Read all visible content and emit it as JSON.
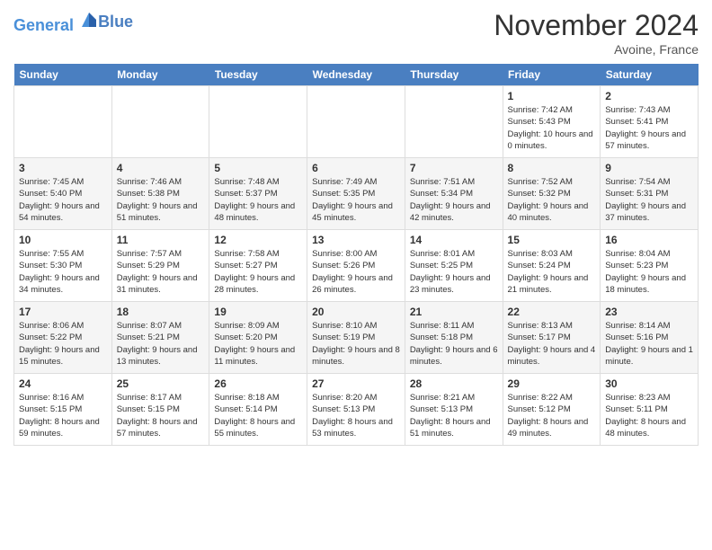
{
  "header": {
    "logo_line1": "General",
    "logo_line2": "Blue",
    "month": "November 2024",
    "location": "Avoine, France"
  },
  "days_of_week": [
    "Sunday",
    "Monday",
    "Tuesday",
    "Wednesday",
    "Thursday",
    "Friday",
    "Saturday"
  ],
  "weeks": [
    [
      {
        "date": "",
        "info": ""
      },
      {
        "date": "",
        "info": ""
      },
      {
        "date": "",
        "info": ""
      },
      {
        "date": "",
        "info": ""
      },
      {
        "date": "",
        "info": ""
      },
      {
        "date": "1",
        "sunrise": "Sunrise: 7:42 AM",
        "sunset": "Sunset: 5:43 PM",
        "daylight": "Daylight: 10 hours and 0 minutes."
      },
      {
        "date": "2",
        "sunrise": "Sunrise: 7:43 AM",
        "sunset": "Sunset: 5:41 PM",
        "daylight": "Daylight: 9 hours and 57 minutes."
      }
    ],
    [
      {
        "date": "3",
        "sunrise": "Sunrise: 7:45 AM",
        "sunset": "Sunset: 5:40 PM",
        "daylight": "Daylight: 9 hours and 54 minutes."
      },
      {
        "date": "4",
        "sunrise": "Sunrise: 7:46 AM",
        "sunset": "Sunset: 5:38 PM",
        "daylight": "Daylight: 9 hours and 51 minutes."
      },
      {
        "date": "5",
        "sunrise": "Sunrise: 7:48 AM",
        "sunset": "Sunset: 5:37 PM",
        "daylight": "Daylight: 9 hours and 48 minutes."
      },
      {
        "date": "6",
        "sunrise": "Sunrise: 7:49 AM",
        "sunset": "Sunset: 5:35 PM",
        "daylight": "Daylight: 9 hours and 45 minutes."
      },
      {
        "date": "7",
        "sunrise": "Sunrise: 7:51 AM",
        "sunset": "Sunset: 5:34 PM",
        "daylight": "Daylight: 9 hours and 42 minutes."
      },
      {
        "date": "8",
        "sunrise": "Sunrise: 7:52 AM",
        "sunset": "Sunset: 5:32 PM",
        "daylight": "Daylight: 9 hours and 40 minutes."
      },
      {
        "date": "9",
        "sunrise": "Sunrise: 7:54 AM",
        "sunset": "Sunset: 5:31 PM",
        "daylight": "Daylight: 9 hours and 37 minutes."
      }
    ],
    [
      {
        "date": "10",
        "sunrise": "Sunrise: 7:55 AM",
        "sunset": "Sunset: 5:30 PM",
        "daylight": "Daylight: 9 hours and 34 minutes."
      },
      {
        "date": "11",
        "sunrise": "Sunrise: 7:57 AM",
        "sunset": "Sunset: 5:29 PM",
        "daylight": "Daylight: 9 hours and 31 minutes."
      },
      {
        "date": "12",
        "sunrise": "Sunrise: 7:58 AM",
        "sunset": "Sunset: 5:27 PM",
        "daylight": "Daylight: 9 hours and 28 minutes."
      },
      {
        "date": "13",
        "sunrise": "Sunrise: 8:00 AM",
        "sunset": "Sunset: 5:26 PM",
        "daylight": "Daylight: 9 hours and 26 minutes."
      },
      {
        "date": "14",
        "sunrise": "Sunrise: 8:01 AM",
        "sunset": "Sunset: 5:25 PM",
        "daylight": "Daylight: 9 hours and 23 minutes."
      },
      {
        "date": "15",
        "sunrise": "Sunrise: 8:03 AM",
        "sunset": "Sunset: 5:24 PM",
        "daylight": "Daylight: 9 hours and 21 minutes."
      },
      {
        "date": "16",
        "sunrise": "Sunrise: 8:04 AM",
        "sunset": "Sunset: 5:23 PM",
        "daylight": "Daylight: 9 hours and 18 minutes."
      }
    ],
    [
      {
        "date": "17",
        "sunrise": "Sunrise: 8:06 AM",
        "sunset": "Sunset: 5:22 PM",
        "daylight": "Daylight: 9 hours and 15 minutes."
      },
      {
        "date": "18",
        "sunrise": "Sunrise: 8:07 AM",
        "sunset": "Sunset: 5:21 PM",
        "daylight": "Daylight: 9 hours and 13 minutes."
      },
      {
        "date": "19",
        "sunrise": "Sunrise: 8:09 AM",
        "sunset": "Sunset: 5:20 PM",
        "daylight": "Daylight: 9 hours and 11 minutes."
      },
      {
        "date": "20",
        "sunrise": "Sunrise: 8:10 AM",
        "sunset": "Sunset: 5:19 PM",
        "daylight": "Daylight: 9 hours and 8 minutes."
      },
      {
        "date": "21",
        "sunrise": "Sunrise: 8:11 AM",
        "sunset": "Sunset: 5:18 PM",
        "daylight": "Daylight: 9 hours and 6 minutes."
      },
      {
        "date": "22",
        "sunrise": "Sunrise: 8:13 AM",
        "sunset": "Sunset: 5:17 PM",
        "daylight": "Daylight: 9 hours and 4 minutes."
      },
      {
        "date": "23",
        "sunrise": "Sunrise: 8:14 AM",
        "sunset": "Sunset: 5:16 PM",
        "daylight": "Daylight: 9 hours and 1 minute."
      }
    ],
    [
      {
        "date": "24",
        "sunrise": "Sunrise: 8:16 AM",
        "sunset": "Sunset: 5:15 PM",
        "daylight": "Daylight: 8 hours and 59 minutes."
      },
      {
        "date": "25",
        "sunrise": "Sunrise: 8:17 AM",
        "sunset": "Sunset: 5:15 PM",
        "daylight": "Daylight: 8 hours and 57 minutes."
      },
      {
        "date": "26",
        "sunrise": "Sunrise: 8:18 AM",
        "sunset": "Sunset: 5:14 PM",
        "daylight": "Daylight: 8 hours and 55 minutes."
      },
      {
        "date": "27",
        "sunrise": "Sunrise: 8:20 AM",
        "sunset": "Sunset: 5:13 PM",
        "daylight": "Daylight: 8 hours and 53 minutes."
      },
      {
        "date": "28",
        "sunrise": "Sunrise: 8:21 AM",
        "sunset": "Sunset: 5:13 PM",
        "daylight": "Daylight: 8 hours and 51 minutes."
      },
      {
        "date": "29",
        "sunrise": "Sunrise: 8:22 AM",
        "sunset": "Sunset: 5:12 PM",
        "daylight": "Daylight: 8 hours and 49 minutes."
      },
      {
        "date": "30",
        "sunrise": "Sunrise: 8:23 AM",
        "sunset": "Sunset: 5:11 PM",
        "daylight": "Daylight: 8 hours and 48 minutes."
      }
    ]
  ]
}
